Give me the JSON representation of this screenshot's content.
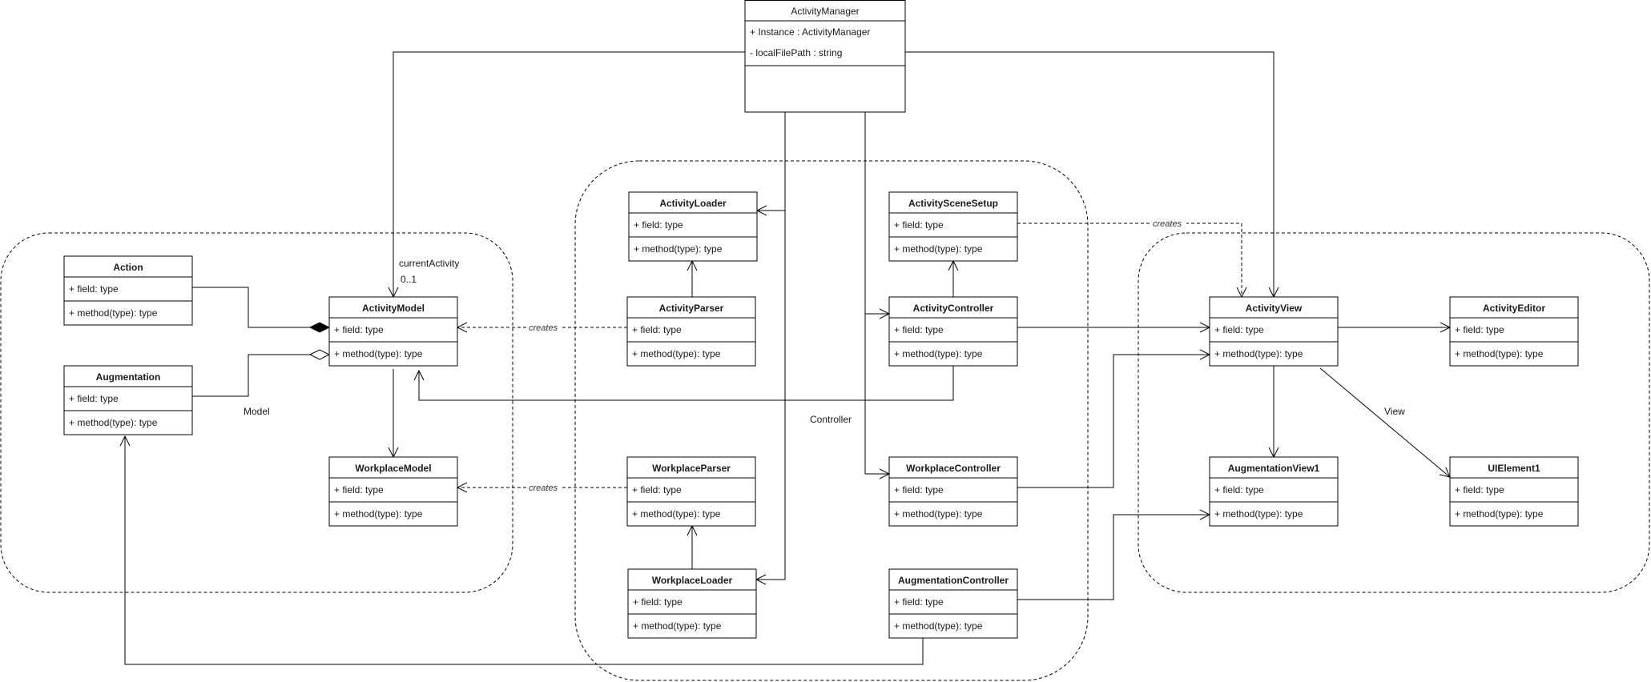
{
  "diagram": {
    "type": "UML class diagram",
    "colors": {
      "stroke": "#000000",
      "text": "#1a1a1a",
      "background": "#ffffff",
      "group_border": "#000000"
    },
    "groups": [
      {
        "id": "model",
        "label": "Model"
      },
      {
        "id": "controller",
        "label": "Controller"
      },
      {
        "id": "view",
        "label": "View"
      }
    ],
    "classes": {
      "ActivityManager": {
        "name": "ActivityManager",
        "bold": false,
        "fields": [
          "+ Instance : ActivityManager",
          "- localFilePath : string"
        ],
        "methods": []
      },
      "Action": {
        "name": "Action",
        "fields": [
          "+ field: type"
        ],
        "methods": [
          "+ method(type): type"
        ]
      },
      "Augmentation": {
        "name": "Augmentation",
        "fields": [
          "+ field: type"
        ],
        "methods": [
          "+ method(type): type"
        ]
      },
      "ActivityModel": {
        "name": "ActivityModel",
        "fields": [
          "+ field: type"
        ],
        "methods": [
          "+ method(type): type"
        ]
      },
      "WorkplaceModel": {
        "name": "WorkplaceModel",
        "fields": [
          "+ field: type"
        ],
        "methods": [
          "+ method(type): type"
        ]
      },
      "ActivityLoader": {
        "name": "ActivityLoader",
        "fields": [
          "+ field: type"
        ],
        "methods": [
          "+ method(type): type"
        ]
      },
      "ActivityParser": {
        "name": "ActivityParser",
        "fields": [
          "+ field: type"
        ],
        "methods": [
          "+ method(type): type"
        ]
      },
      "WorkplaceParser": {
        "name": "WorkplaceParser",
        "fields": [
          "+ field: type"
        ],
        "methods": [
          "+ method(type): type"
        ]
      },
      "WorkplaceLoader": {
        "name": "WorkplaceLoader",
        "fields": [
          "+ field: type"
        ],
        "methods": [
          "+ method(type): type"
        ]
      },
      "ActivitySceneSetup": {
        "name": "ActivitySceneSetup",
        "fields": [
          "+ field: type"
        ],
        "methods": [
          "+ method(type): type"
        ]
      },
      "ActivityController": {
        "name": "ActivityController",
        "fields": [
          "+ field: type"
        ],
        "methods": [
          "+ method(type): type"
        ]
      },
      "WorkplaceController": {
        "name": "WorkplaceController",
        "fields": [
          "+ field: type"
        ],
        "methods": [
          "+ method(type): type"
        ]
      },
      "AugmentationController": {
        "name": "AugmentationController",
        "fields": [
          "+ field: type"
        ],
        "methods": [
          "+ method(type): type"
        ]
      },
      "ActivityView": {
        "name": "ActivityView",
        "fields": [
          "+ field: type"
        ],
        "methods": [
          "+ method(type): type"
        ]
      },
      "ActivityEditor": {
        "name": "ActivityEditor",
        "fields": [
          "+ field: type"
        ],
        "methods": [
          "+ method(type): type"
        ]
      },
      "AugmentationView1": {
        "name": "AugmentationView1",
        "fields": [
          "+ field: type"
        ],
        "methods": [
          "+ method(type): type"
        ]
      },
      "UIElement1": {
        "name": "UIElement1",
        "fields": [
          "+ field: type"
        ],
        "methods": [
          "+ method(type): type"
        ]
      }
    },
    "relations": [
      {
        "from": "ActivityManager",
        "to": "ActivityModel",
        "kind": "association",
        "role": "currentActivity",
        "multiplicity": "0..1"
      },
      {
        "from": "ActivityManager",
        "to": "ActivityView",
        "kind": "association"
      },
      {
        "from": "ActivityManager",
        "to": "ActivityLoader",
        "kind": "association"
      },
      {
        "from": "ActivityManager",
        "to": "WorkplaceLoader",
        "kind": "association"
      },
      {
        "from": "ActivityManager",
        "to": "ActivityController",
        "kind": "association"
      },
      {
        "from": "ActivityManager",
        "to": "WorkplaceController",
        "kind": "association"
      },
      {
        "from": "Action",
        "to": "ActivityModel",
        "kind": "composition"
      },
      {
        "from": "Augmentation",
        "to": "ActivityModel",
        "kind": "aggregation"
      },
      {
        "from": "ActivityModel",
        "to": "WorkplaceModel",
        "kind": "association"
      },
      {
        "from": "ActivityParser",
        "to": "ActivityModel",
        "kind": "dependency",
        "label": "creates"
      },
      {
        "from": "WorkplaceParser",
        "to": "WorkplaceModel",
        "kind": "dependency",
        "label": "creates"
      },
      {
        "from": "ActivityParser",
        "to": "ActivityLoader",
        "kind": "association"
      },
      {
        "from": "WorkplaceLoader",
        "to": "WorkplaceParser",
        "kind": "association"
      },
      {
        "from": "ActivityController",
        "to": "ActivitySceneSetup",
        "kind": "association"
      },
      {
        "from": "ActivityController",
        "to": "ActivityModel",
        "kind": "association"
      },
      {
        "from": "ActivityController",
        "to": "ActivityView",
        "kind": "association"
      },
      {
        "from": "ActivitySceneSetup",
        "to": "ActivityView",
        "kind": "dependency",
        "label": "creates"
      },
      {
        "from": "WorkplaceController",
        "to": "ActivityView",
        "kind": "association"
      },
      {
        "from": "AugmentationController",
        "to": "AugmentationView1",
        "kind": "association"
      },
      {
        "from": "AugmentationController",
        "to": "Augmentation",
        "kind": "association"
      },
      {
        "from": "ActivityView",
        "to": "ActivityEditor",
        "kind": "association"
      },
      {
        "from": "ActivityView",
        "to": "AugmentationView1",
        "kind": "association"
      },
      {
        "from": "ActivityView",
        "to": "UIElement1",
        "kind": "association"
      }
    ],
    "labels": {
      "creates": "creates",
      "current_activity": "currentActivity",
      "multiplicity": "0..1",
      "model": "Model",
      "controller": "Controller",
      "view": "View"
    }
  }
}
